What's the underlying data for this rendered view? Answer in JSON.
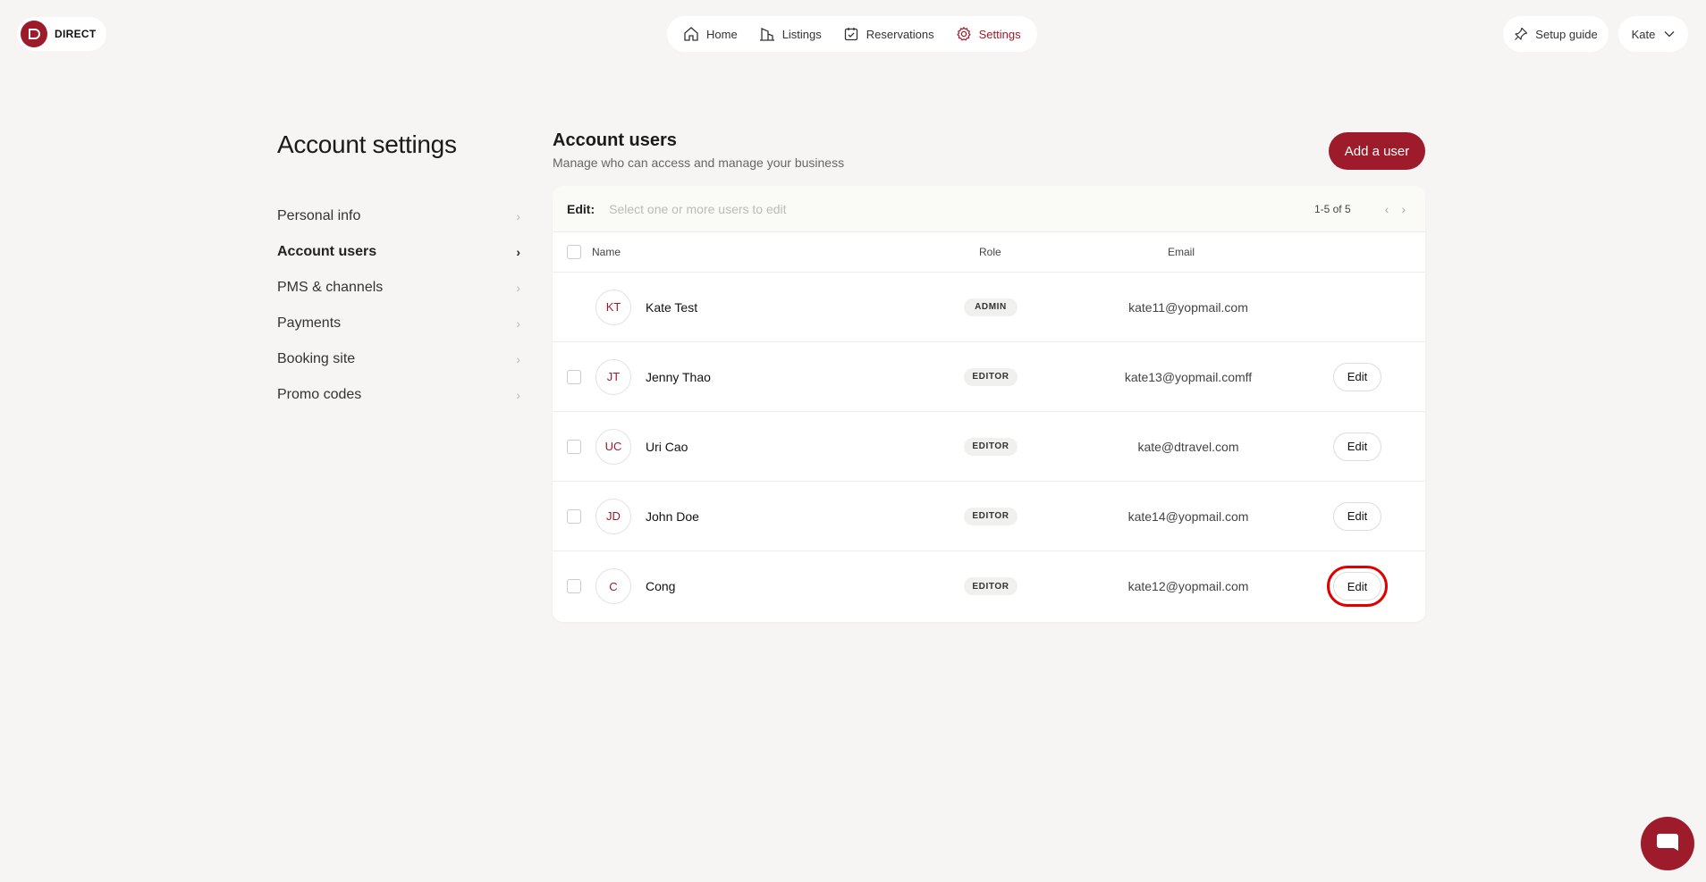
{
  "brand": {
    "name": "DIRECT",
    "accent": "#9e1b2b"
  },
  "topnav": {
    "items": [
      {
        "label": "Home",
        "icon": "home-icon",
        "active": false
      },
      {
        "label": "Listings",
        "icon": "building-icon",
        "active": false
      },
      {
        "label": "Reservations",
        "icon": "calendar-check-icon",
        "active": false
      },
      {
        "label": "Settings",
        "icon": "gear-icon",
        "active": true
      }
    ]
  },
  "header": {
    "setup_label": "Setup guide",
    "user_name": "Kate"
  },
  "settings": {
    "title": "Account settings",
    "items": [
      {
        "label": "Personal info"
      },
      {
        "label": "Account users"
      },
      {
        "label": "PMS & channels"
      },
      {
        "label": "Payments"
      },
      {
        "label": "Booking site"
      },
      {
        "label": "Promo codes"
      }
    ]
  },
  "main": {
    "title": "Account users",
    "subtitle": "Manage who can access and manage your business",
    "add_label": "Add a user",
    "edit_bar": {
      "label": "Edit:",
      "hint": "Select one or more users to edit",
      "count": "1-5 of 5"
    },
    "columns": {
      "name": "Name",
      "role": "Role",
      "email": "Email"
    },
    "edit_label": "Edit",
    "users": [
      {
        "initials": "KT",
        "name": "Kate Test",
        "role": "ADMIN",
        "email": "kate11@yopmail.com"
      },
      {
        "initials": "JT",
        "name": "Jenny Thao",
        "role": "EDITOR",
        "email": "kate13@yopmail.comff"
      },
      {
        "initials": "UC",
        "name": "Uri Cao",
        "role": "EDITOR",
        "email": "kate@dtravel.com"
      },
      {
        "initials": "JD",
        "name": "John Doe",
        "role": "EDITOR",
        "email": "kate14@yopmail.com"
      },
      {
        "initials": "C",
        "name": "Cong",
        "role": "EDITOR",
        "email": "kate12@yopmail.com"
      }
    ]
  }
}
